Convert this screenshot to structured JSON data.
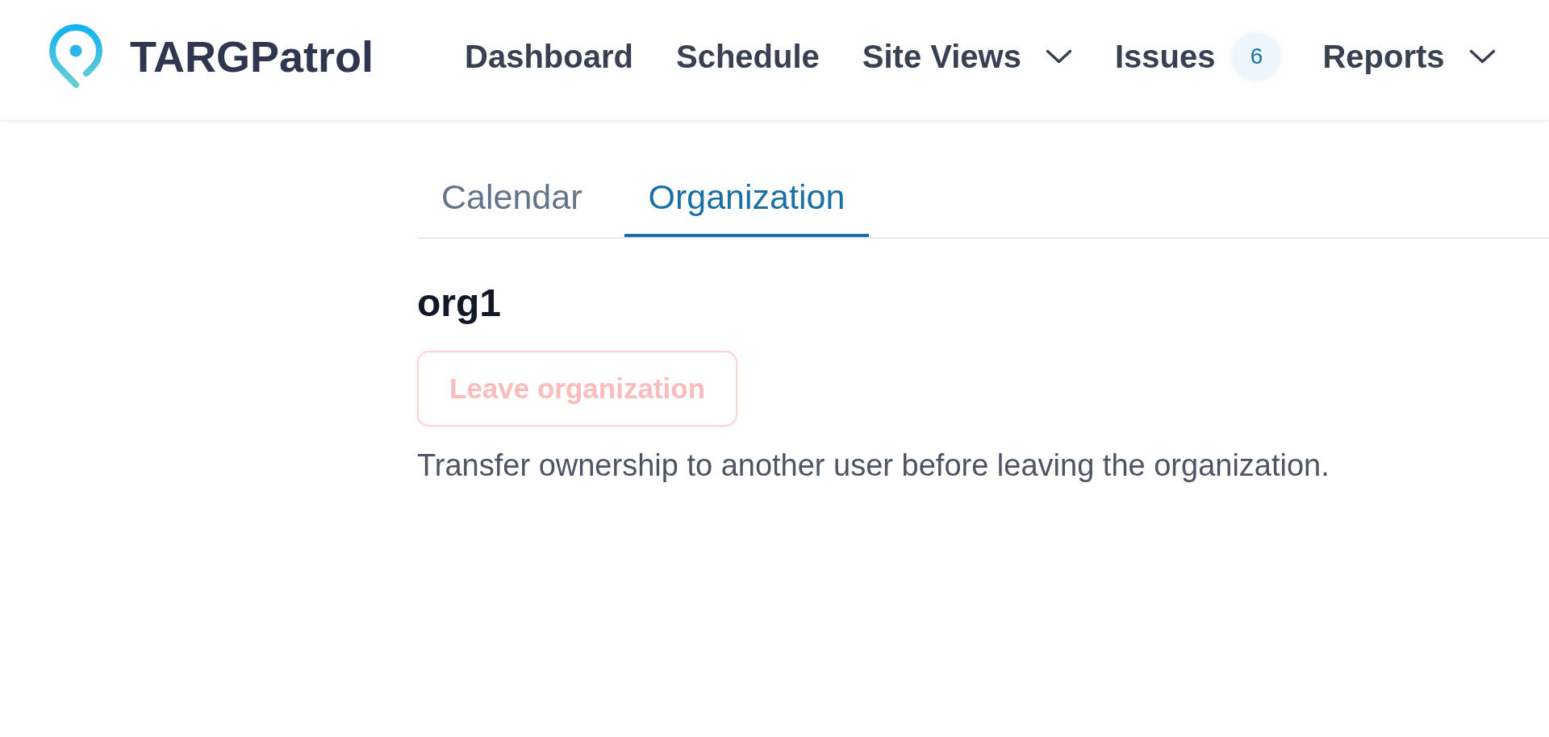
{
  "brand": {
    "name": "TARGPatrol"
  },
  "nav": [
    {
      "label": "Dashboard",
      "kind": "link"
    },
    {
      "label": "Schedule",
      "kind": "link"
    },
    {
      "label": "Site Views",
      "kind": "dropdown"
    },
    {
      "label": "Issues",
      "kind": "link",
      "badge": "6"
    },
    {
      "label": "Reports",
      "kind": "dropdown"
    }
  ],
  "tabs": [
    {
      "label": "Calendar",
      "selected": false
    },
    {
      "label": "Organization",
      "selected": true
    }
  ],
  "organization": {
    "name": "org1",
    "leave_button": {
      "label": "Leave organization",
      "disabled": true
    },
    "note": "Transfer ownership to another user before leaving the organization."
  }
}
